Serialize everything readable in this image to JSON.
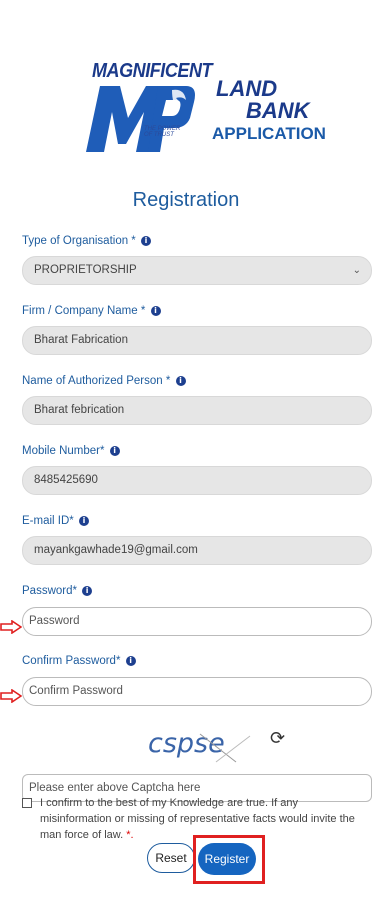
{
  "logo": {
    "magnificent": "MAGNIFICENT",
    "mp": "MP",
    "tagline": "THE POWER OF TRUST",
    "land": "LAND",
    "bank": "BANK",
    "application": "APPLICATION"
  },
  "page_title": "Registration",
  "info_glyph": "i",
  "fields": {
    "organisation": {
      "label": "Type of Organisation *",
      "value": "PROPRIETORSHIP"
    },
    "firm": {
      "label": "Firm / Company Name *",
      "value": "Bharat  Fabrication"
    },
    "authorized": {
      "label": "Name of Authorized Person *",
      "value": "Bharat  febrication"
    },
    "mobile": {
      "label": "Mobile Number*",
      "value": "8485425690"
    },
    "email": {
      "label": "E-mail ID*",
      "value": "mayankgawhade19@gmail.com"
    },
    "password": {
      "label": "Password*",
      "placeholder": "Password"
    },
    "confirm_password": {
      "label": "Confirm Password*",
      "placeholder": "Confirm Password"
    }
  },
  "captcha": {
    "text": "cspse",
    "placeholder": "Please enter above Captcha here"
  },
  "confirm_text": "I confirm to the best of my Knowledge are true. If any misinformation or missing of representative facts would invite the man force of law.",
  "confirm_required": "*.",
  "buttons": {
    "reset": "Reset",
    "register": "Register"
  },
  "colors": {
    "accent": "#1e5c9e",
    "button": "#1565c0",
    "annotation": "#e02020"
  },
  "icons": {
    "info": "info-icon",
    "refresh": "refresh-icon",
    "chevron": "chevron-down-icon",
    "arrow": "arrow-right-icon"
  }
}
